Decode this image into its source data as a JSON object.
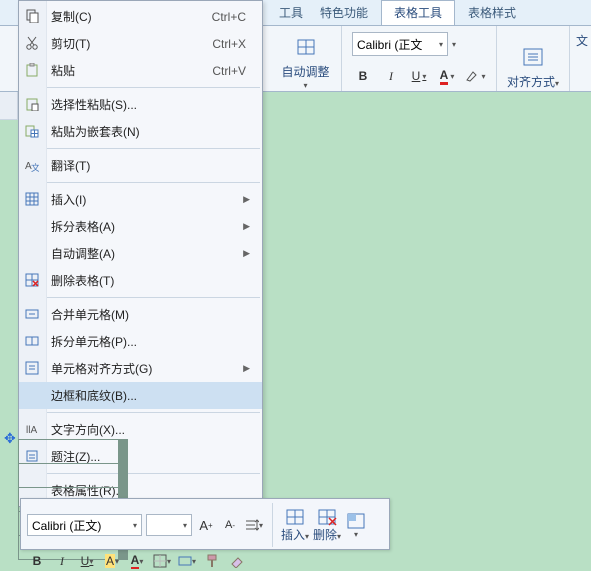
{
  "tabs": {
    "frag1": "工具",
    "t_special": "特色功能",
    "t_table_tools": "表格工具",
    "t_table_style": "表格样式"
  },
  "ribbon": {
    "font_name": "Calibri (正文",
    "autofit": "自动调整",
    "bold": "B",
    "italic": "I",
    "underline": "U",
    "align_label": "对齐方式",
    "frag_right": "文"
  },
  "menu": {
    "copy": "复制(C)",
    "copy_sc": "Ctrl+C",
    "cut": "剪切(T)",
    "cut_sc": "Ctrl+X",
    "paste": "粘贴",
    "paste_sc": "Ctrl+V",
    "paste_spec": "选择性粘贴(S)...",
    "paste_nested": "粘贴为嵌套表(N)",
    "translate": "翻译(T)",
    "insert": "插入(I)",
    "split_table": "拆分表格(A)",
    "autoadjust": "自动调整(A)",
    "delete_table": "删除表格(T)",
    "merge_cells": "合并单元格(M)",
    "split_cells": "拆分单元格(P)...",
    "cell_align": "单元格对齐方式(G)",
    "borders": "边框和底纹(B)...",
    "text_dir": "文字方向(X)...",
    "caption": "题注(Z)...",
    "table_props": "表格属性(R)..."
  },
  "float": {
    "font_name": "Calibri (正文)",
    "font_inc": "A⁺",
    "font_dec": "A⁻",
    "bold": "B",
    "italic": "I",
    "underline": "U",
    "hlA": "A",
    "colorA": "A",
    "insert": "插入",
    "delete": "删除"
  }
}
